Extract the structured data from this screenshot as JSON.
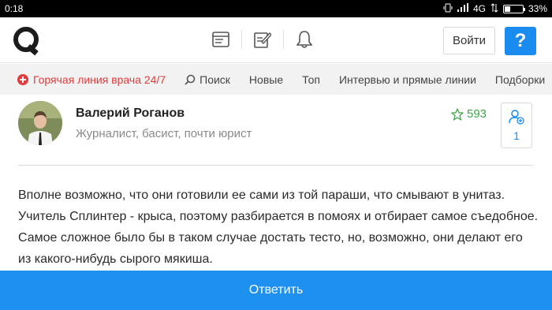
{
  "status_bar": {
    "time": "0:18",
    "network": "4G",
    "battery": "33%"
  },
  "header": {
    "login_label": "Войти",
    "help_label": "?"
  },
  "nav": {
    "hotline": "Горячая линия врача 24/7",
    "search": "Поиск",
    "items": [
      "Новые",
      "Топ",
      "Интервью и прямые линии",
      "Подборки"
    ]
  },
  "post": {
    "author_name": "Валерий Роганов",
    "author_desc": "Журналист, басист, почти юрист",
    "rating": "593",
    "followers": "1",
    "text": "Вполне возможно, что они готовили ее сами из той параши, что смывают в унитаз. Учитель Сплинтер - крыса, поэтому разбирается в помоях и отбирает самое съедобное. Самое сложное было бы в таком случае достать тесто, но, возможно, они делают его из какого-нибудь сырого мякиша."
  },
  "reply_label": "Ответить",
  "colors": {
    "accent": "#1e90f0",
    "hotline": "#e23b3b",
    "rating": "#3ea64a"
  }
}
